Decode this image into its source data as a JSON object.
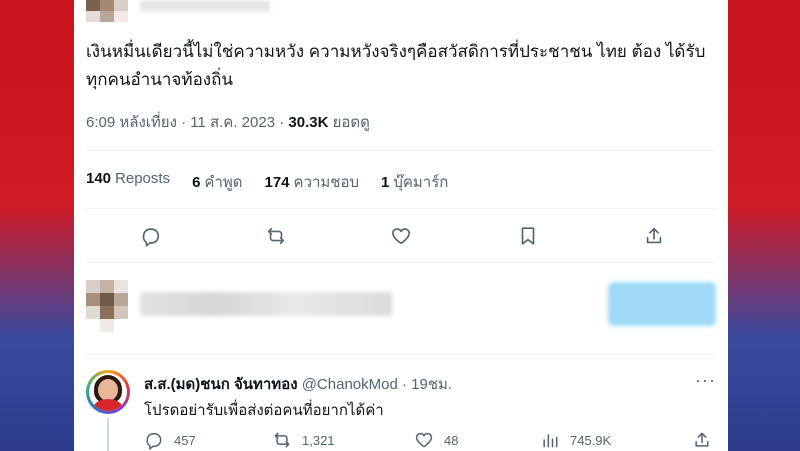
{
  "tweet": {
    "text": "เงินหมื่นเดียวนี้ไม่ใช่ความหวัง ความหวังจริงๆคือสวัสดิการที่ประชาชน ไทย ต้อง ได้รับ ทุกคนอำนาจท้องถิ่น",
    "time": "6:09 หลังเที่ยง",
    "date": "11 ส.ค. 2023",
    "views_count": "30.3K",
    "views_label": "ยอดดู",
    "sep": "·"
  },
  "stats": [
    {
      "count": "140",
      "label": "Reposts"
    },
    {
      "count": "6",
      "label": "คำพูด"
    },
    {
      "count": "174",
      "label": "ความชอบ"
    },
    {
      "count": "1",
      "label": "บุ๊คมาร์ก"
    }
  ],
  "actions": [
    "reply-icon",
    "repost-icon",
    "like-icon",
    "bookmark-icon",
    "share-icon"
  ],
  "reply": {
    "name": "ส.ส.(มด)ชนก จันทาทอง",
    "handle": "@ChanokMod",
    "time": "· 19ชม.",
    "text": "โปรดอย่ารับเพื่อส่งต่อคนที่อยากได้ค่า",
    "more": "···",
    "replies": "457",
    "reposts": "1,321",
    "likes": "48",
    "views": "745.9K"
  },
  "colors": {
    "muted": "#536471",
    "text": "#0f1419",
    "accent_blur": "#8fd3f4"
  }
}
